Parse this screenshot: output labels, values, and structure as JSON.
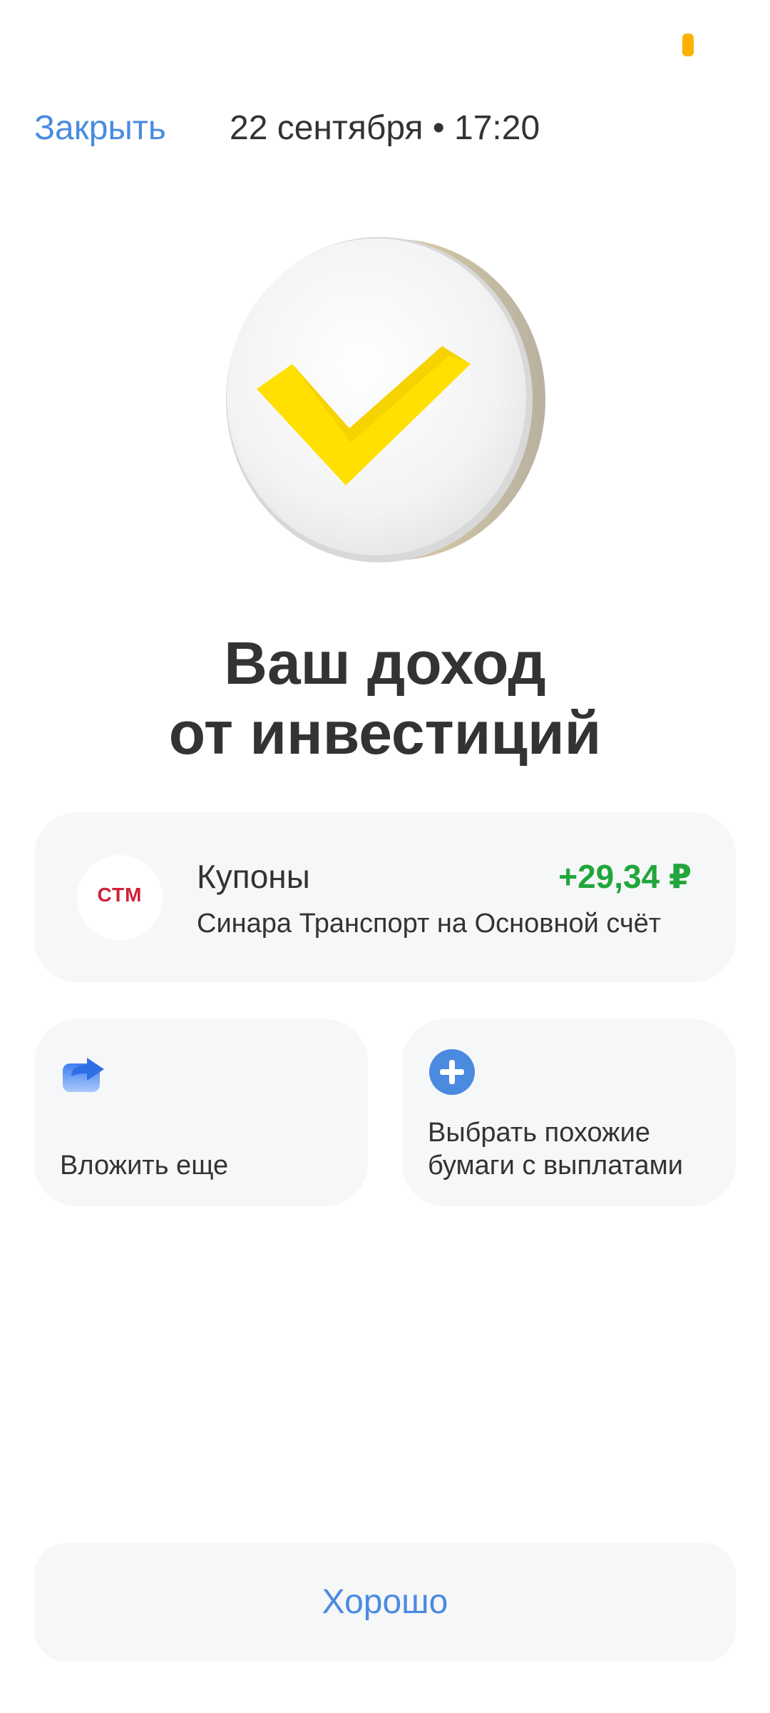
{
  "header": {
    "close_label": "Закрыть",
    "datetime": "22 сентября • 17:20"
  },
  "hero": {
    "icon": "check-coin-icon"
  },
  "title": {
    "line1": "Ваш доход",
    "line2": "от инвестиций"
  },
  "coupon": {
    "logo_text": "СТМ",
    "title": "Купоны",
    "amount": "+29,34 ₽",
    "description_part1": "Синара Транспорт",
    "description_part2": "на Основной счёт",
    "amount_color": "#22a63c"
  },
  "actions": [
    {
      "label": "Вложить еще",
      "icon": "share-arrow-icon"
    },
    {
      "label_line1": "Выбрать похожие",
      "label_line2": "бумаги с выплатами",
      "icon": "plus-circle-icon"
    }
  ],
  "footer": {
    "ok_label": "Хорошо"
  },
  "colors": {
    "accent": "#4a8be0",
    "status": "#ffb100",
    "check": "#ffe000"
  }
}
